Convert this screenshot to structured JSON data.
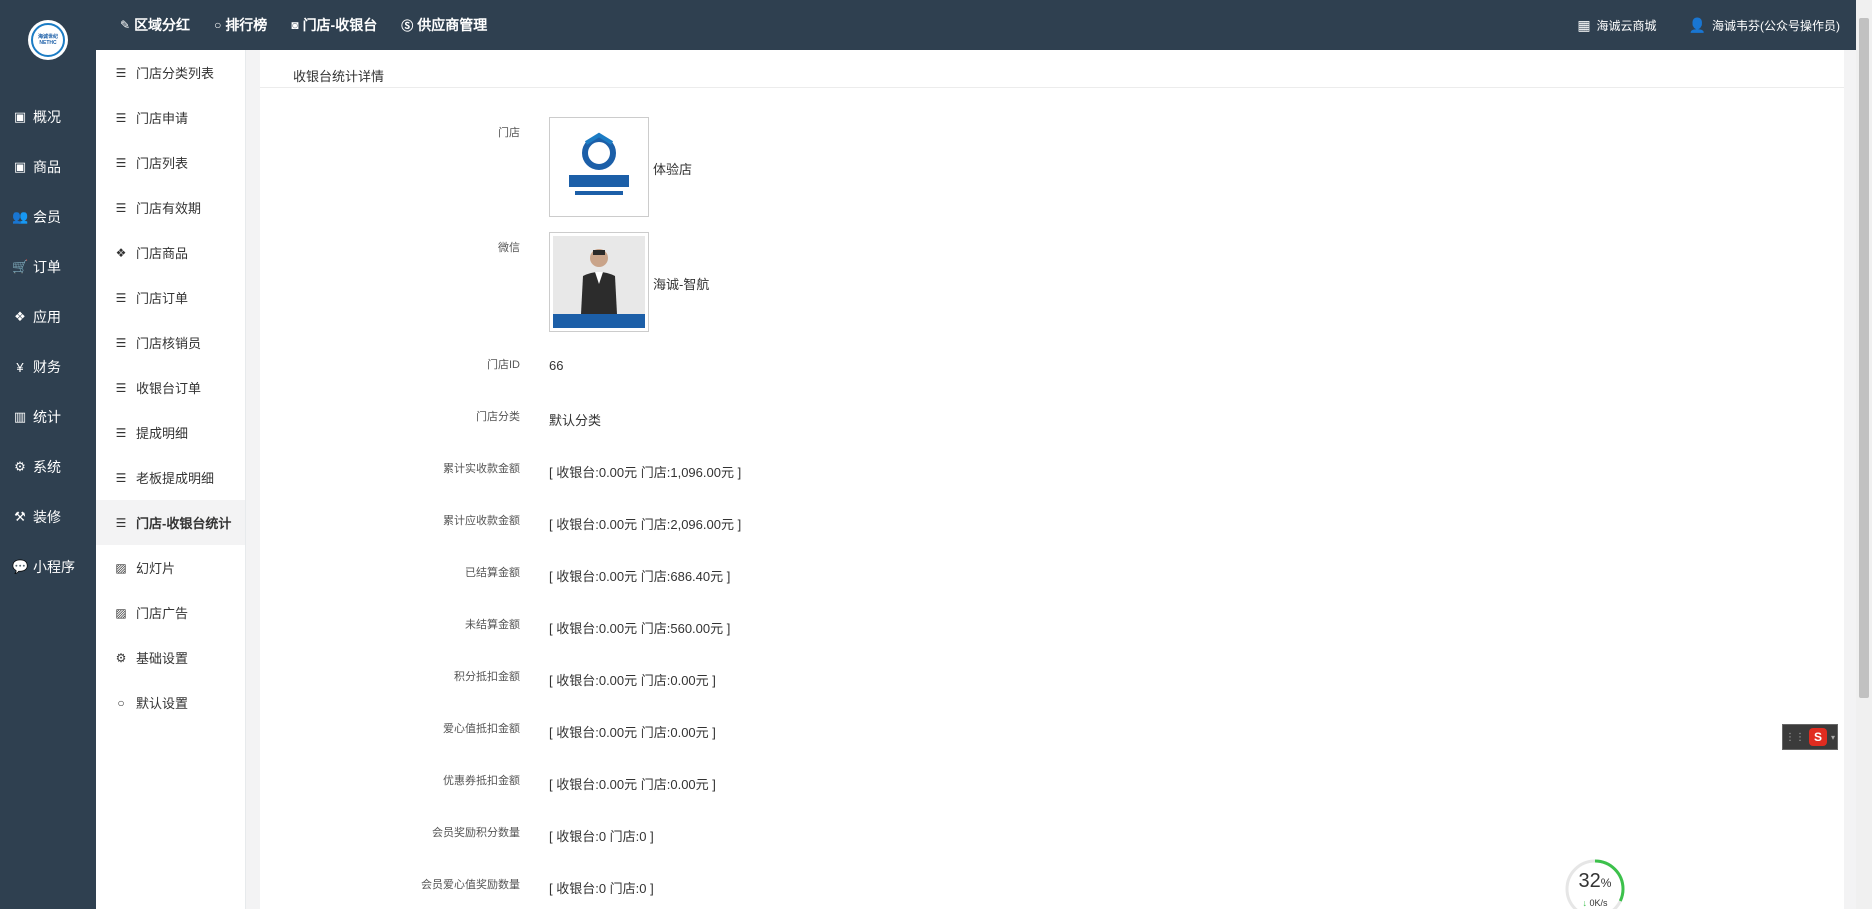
{
  "top_nav": [
    {
      "label": "区域分红",
      "icon": "pin-icon"
    },
    {
      "label": "排行榜",
      "icon": "circle-icon"
    },
    {
      "label": "门店-收银台",
      "icon": "register-icon"
    },
    {
      "label": "供应商管理",
      "icon": "skype-icon"
    }
  ],
  "top_right": {
    "shop_label": "海诚云商城",
    "user_label": "海诚韦芬(公众号操作员)"
  },
  "logo": {
    "brand": "海诚世纪",
    "sub": "NETHC"
  },
  "main_nav": [
    {
      "label": "概况",
      "icon": "dashboard-icon"
    },
    {
      "label": "商品",
      "icon": "box-icon"
    },
    {
      "label": "会员",
      "icon": "users-icon"
    },
    {
      "label": "订单",
      "icon": "cart-icon"
    },
    {
      "label": "应用",
      "icon": "cubes-icon"
    },
    {
      "label": "财务",
      "icon": "yen-icon"
    },
    {
      "label": "统计",
      "icon": "bar-chart-icon"
    },
    {
      "label": "系统",
      "icon": "gears-icon"
    },
    {
      "label": "装修",
      "icon": "hammer-icon"
    },
    {
      "label": "小程序",
      "icon": "wechat-icon"
    }
  ],
  "sub_nav": [
    {
      "label": "门店分类列表",
      "icon": "list-icon"
    },
    {
      "label": "门店申请",
      "icon": "list-icon"
    },
    {
      "label": "门店列表",
      "icon": "list-icon"
    },
    {
      "label": "门店有效期",
      "icon": "list-icon"
    },
    {
      "label": "门店商品",
      "icon": "cubes-icon"
    },
    {
      "label": "门店订单",
      "icon": "list-icon"
    },
    {
      "label": "门店核销员",
      "icon": "list-icon"
    },
    {
      "label": "收银台订单",
      "icon": "list-icon"
    },
    {
      "label": "提成明细",
      "icon": "list-icon"
    },
    {
      "label": "老板提成明细",
      "icon": "list-icon"
    },
    {
      "label": "门店-收银台统计",
      "icon": "list-icon",
      "active": true
    },
    {
      "label": "幻灯片",
      "icon": "image-icon"
    },
    {
      "label": "门店广告",
      "icon": "image-icon"
    },
    {
      "label": "基础设置",
      "icon": "gears-icon"
    },
    {
      "label": "默认设置",
      "icon": "circle-icon"
    }
  ],
  "content": {
    "title": "收银台统计详情",
    "store": {
      "label": "门店",
      "name": "体验店"
    },
    "wechat": {
      "label": "微信",
      "name": "海诚-智航"
    },
    "rows": [
      {
        "label": "门店ID",
        "value": "66"
      },
      {
        "label": "门店分类",
        "value": "默认分类"
      },
      {
        "label": "累计实收款金额",
        "value": "[ 收银台:0.00元 门店:1,096.00元 ]"
      },
      {
        "label": "累计应收款金额",
        "value": "[ 收银台:0.00元 门店:2,096.00元 ]"
      },
      {
        "label": "已结算金额",
        "value": "[ 收银台:0.00元 门店:686.40元 ]"
      },
      {
        "label": "未结算金额",
        "value": "[ 收银台:0.00元 门店:560.00元 ]"
      },
      {
        "label": "积分抵扣金额",
        "value": "[ 收银台:0.00元 门店:0.00元 ]"
      },
      {
        "label": "爱心值抵扣金额",
        "value": "[ 收银台:0.00元 门店:0.00元 ]"
      },
      {
        "label": "优惠券抵扣金额",
        "value": "[ 收银台:0.00元 门店:0.00元 ]"
      },
      {
        "label": "会员奖励积分数量",
        "value": "[ 收银台:0 门店:0 ]"
      },
      {
        "label": "会员爱心值奖励数量",
        "value": "[ 收银台:0 门店:0 ]"
      }
    ]
  },
  "speed_widget": {
    "percent": "32",
    "unit": "%",
    "rate": "0K/s"
  },
  "colors": {
    "sidebar": "#2f4050",
    "content": "#ffffff",
    "accent": "#1c7cc4",
    "progress": "#3cc14b"
  }
}
